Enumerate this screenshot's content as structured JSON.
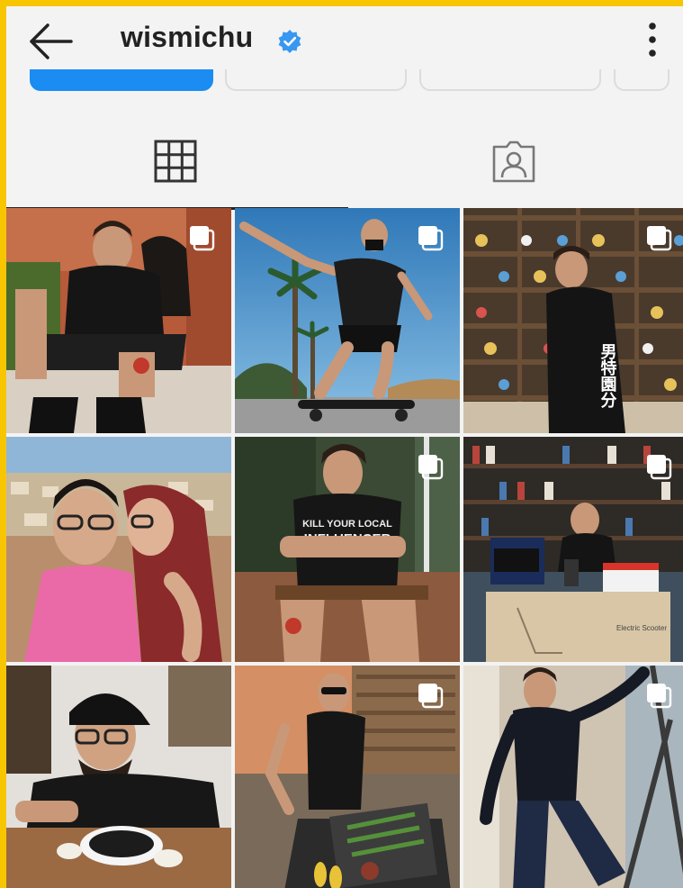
{
  "header": {
    "username": "wismichu",
    "back_icon": "arrow-left-icon",
    "verified_icon": "verified-badge-icon",
    "menu_icon": "more-vertical-icon"
  },
  "highlights": {
    "count": 4,
    "active_index": 0
  },
  "tabs": [
    {
      "name": "grid",
      "icon": "grid-icon",
      "active": true
    },
    {
      "name": "tagged",
      "icon": "tagged-person-icon",
      "active": false
    }
  ],
  "posts": [
    {
      "id": 1,
      "multiple": true,
      "caption_text": ""
    },
    {
      "id": 2,
      "multiple": true,
      "caption_text": ""
    },
    {
      "id": 3,
      "multiple": true,
      "caption_text": "男 特 園 分"
    },
    {
      "id": 4,
      "multiple": false,
      "caption_text": ""
    },
    {
      "id": 5,
      "multiple": true,
      "caption_text": "KILL YOUR LOCAL INFLUENCER"
    },
    {
      "id": 6,
      "multiple": true,
      "caption_text": "Electric Scooter"
    },
    {
      "id": 7,
      "multiple": false,
      "caption_text": ""
    },
    {
      "id": 8,
      "multiple": true,
      "caption_text": ""
    },
    {
      "id": 9,
      "multiple": true,
      "caption_text": ""
    }
  ],
  "colors": {
    "frame": "#f7c600",
    "accent": "#1a8cf2",
    "verified": "#3897f0"
  }
}
